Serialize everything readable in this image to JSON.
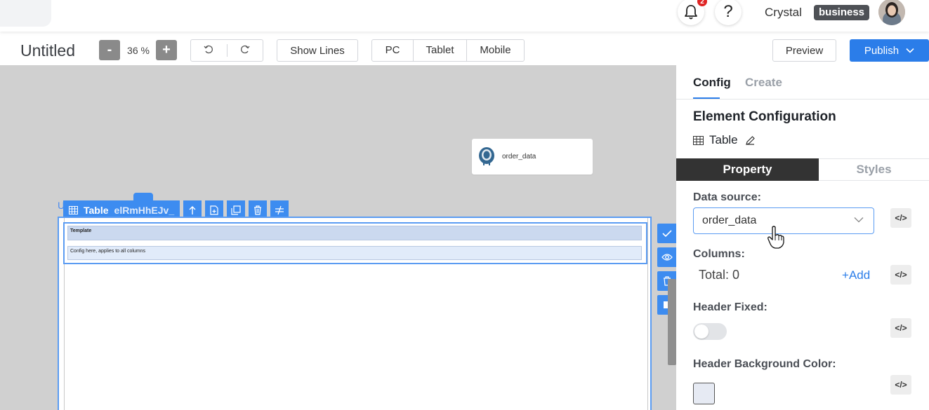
{
  "header": {
    "notifications": {
      "icon": "bell-icon",
      "count": "2"
    },
    "help": {
      "icon": "help-icon",
      "label": "?"
    },
    "user": {
      "name": "Crystal",
      "plan": "business",
      "avatar_icon": "avatar"
    }
  },
  "toolbar": {
    "title": "Untitled",
    "zoom": {
      "minus": "-",
      "value": "36 %",
      "plus": "+"
    },
    "undo_icon": "undo-icon",
    "redo_icon": "redo-icon",
    "show_lines": "Show Lines",
    "devices": [
      "PC",
      "Tablet",
      "Mobile"
    ],
    "preview": "Preview",
    "publish": "Publish"
  },
  "canvas": {
    "datasource_card": {
      "label": "order_data",
      "icon": "postgresql-icon"
    },
    "ghost_label": "U",
    "selected": {
      "type": "Table",
      "id": "elRmHhEJv_",
      "actions": [
        "move-up-icon",
        "new-page-icon",
        "duplicate-icon",
        "delete-icon",
        "swap-icon"
      ]
    },
    "template": {
      "row1": "Template",
      "row2": "Config here, applies to all columns"
    },
    "side_actions": [
      "check-icon",
      "eye-icon",
      "delete-icon",
      "square-icon"
    ]
  },
  "panel": {
    "tabs": [
      "Config",
      "Create"
    ],
    "active_tab": "Config",
    "section_title": "Element Configuration",
    "element": {
      "icon": "table-icon",
      "name": "Table",
      "edit_icon": "pencil-icon"
    },
    "segments": [
      "Property",
      "Styles"
    ],
    "active_segment": "Property",
    "data_source": {
      "label": "Data source:",
      "value": "order_data"
    },
    "columns": {
      "label": "Columns:",
      "total": "Total: 0",
      "add": "Add"
    },
    "header_fixed": {
      "label": "Header Fixed:",
      "checked": false
    },
    "header_bg": {
      "label": "Header Background Color:",
      "color": "#e6eaf3"
    },
    "code_icon": "code-icon"
  },
  "colors": {
    "accent": "#2b7de9",
    "selection": "#3d8cf0",
    "canvas": "#d0d0d0"
  }
}
